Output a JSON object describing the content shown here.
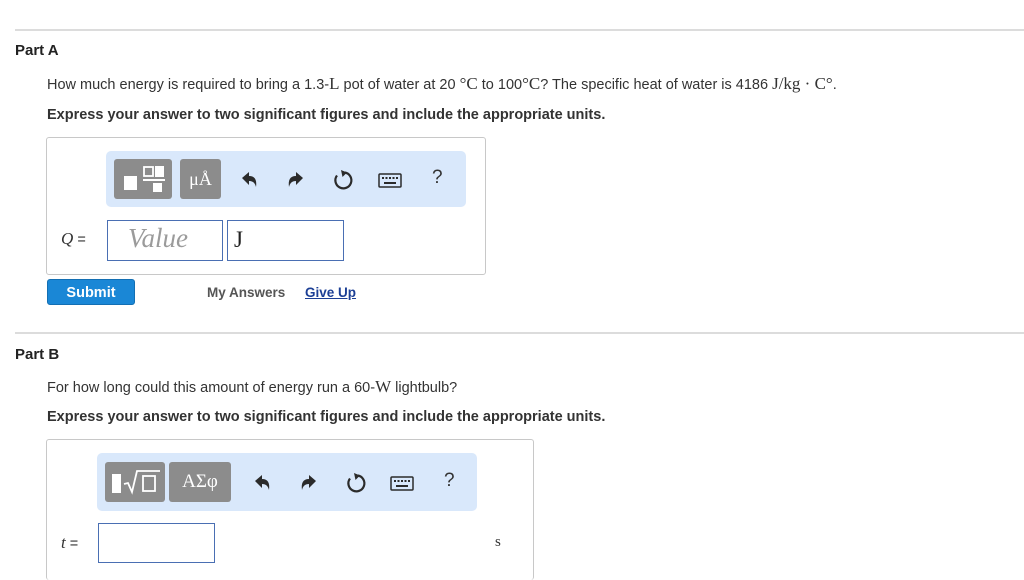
{
  "partA": {
    "title": "Part A",
    "question_pre": "How much energy is required to bring a 1.3-",
    "q_L": "L",
    "q_mid1": " pot of water at 20 ",
    "q_degC": "°C",
    "q_mid2": " to 100",
    "q_degC2": "°C",
    "q_mid3": "? The specific heat of water is 4186 ",
    "q_units": "J/kg · C°",
    "q_end": ".",
    "instruction": "Express your answer to two significant figures and include the appropriate units.",
    "toolbar": {
      "template_icon": "fraction-template-icon",
      "units_label": "μÅ",
      "undo_icon": "undo-icon",
      "redo_icon": "redo-icon",
      "reset_icon": "reset-icon",
      "keyboard_icon": "keyboard-icon",
      "help_label": "?"
    },
    "variable": "Q",
    "equals": "=",
    "value_placeholder": "Value",
    "unit_value": "J",
    "submit_label": "Submit",
    "my_answers_label": "My Answers",
    "give_up_label": "Give Up"
  },
  "partB": {
    "title": "Part B",
    "question_pre": "For how long could this amount of energy run a 60-",
    "q_W": "W",
    "q_end": " lightbulb?",
    "instruction": "Express your answer to two significant figures and include the appropriate units.",
    "toolbar": {
      "template_icon": "sqrt-template-icon",
      "greek_label": "ΑΣφ",
      "undo_icon": "undo-icon",
      "redo_icon": "redo-icon",
      "reset_icon": "reset-icon",
      "keyboard_icon": "keyboard-icon",
      "help_label": "?"
    },
    "variable": "t",
    "equals": "=",
    "unit_value": "s"
  },
  "colors": {
    "toolbar_bg": "#d9e8fb",
    "submit_bg": "#1a87d6",
    "give_up_link": "#1c3f95"
  }
}
